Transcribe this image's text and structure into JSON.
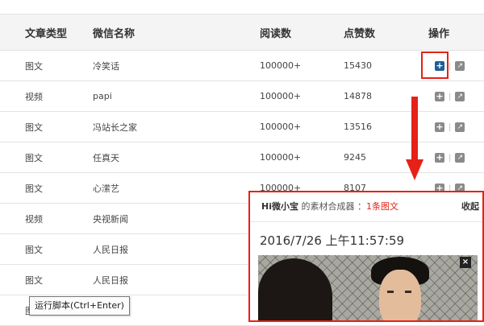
{
  "table": {
    "headers": [
      "文章类型",
      "微信名称",
      "阅读数",
      "点赞数",
      "操作"
    ],
    "rows": [
      {
        "type": "图文",
        "name": "冷笑话",
        "reads": "100000+",
        "likes": "15430"
      },
      {
        "type": "视频",
        "name": "papi",
        "reads": "100000+",
        "likes": "14878"
      },
      {
        "type": "图文",
        "name": "冯站长之家",
        "reads": "100000+",
        "likes": "13516"
      },
      {
        "type": "图文",
        "name": "任真天",
        "reads": "100000+",
        "likes": "9245"
      },
      {
        "type": "图文",
        "name": "心潆艺",
        "reads": "100000+",
        "likes": "8107"
      },
      {
        "type": "视频",
        "name": "央视新闻",
        "reads": "",
        "likes": ""
      },
      {
        "type": "图文",
        "name": "人民日报",
        "reads": "",
        "likes": ""
      },
      {
        "type": "图文",
        "name": "人民日报",
        "reads": "",
        "likes": ""
      },
      {
        "type": "图文",
        "name": "",
        "reads": "",
        "likes": ""
      }
    ],
    "ops": {
      "add_icon": "plus-icon",
      "separator": "|",
      "share_icon": "share-icon"
    }
  },
  "popup": {
    "owner": "Hi微小宝",
    "text": " 的素材合成器 ：",
    "count": "1条图文",
    "collapse": "收起",
    "timestamp": "2016/7/26 上午11:57:59",
    "close": "×"
  },
  "tooltip": "运行脚本(Ctrl+Enter)",
  "colors": {
    "accent_red": "#e62117",
    "active_blue": "#1e5f99"
  }
}
